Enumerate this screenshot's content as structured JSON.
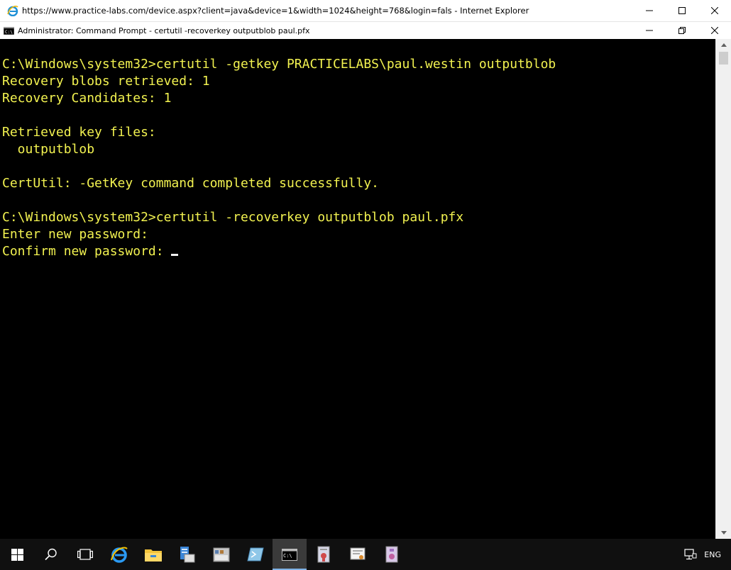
{
  "browser_window": {
    "title": "https://www.practice-labs.com/device.aspx?client=java&device=1&width=1024&height=768&login=fals - Internet Explorer",
    "icon": "ie-icon"
  },
  "cmd_window": {
    "title": "Administrator: Command Prompt - certutil  -recoverkey outputblob paul.pfx",
    "icon": "cmd-icon"
  },
  "console": {
    "text_color": "#f2f250",
    "background": "#000000",
    "lines": [
      "C:\\Windows\\system32>certutil -getkey PRACTICELABS\\paul.westin outputblob",
      "Recovery blobs retrieved: 1",
      "Recovery Candidates: 1",
      "",
      "Retrieved key files:",
      "  outputblob",
      "",
      "CertUtil: -GetKey command completed successfully.",
      "",
      "C:\\Windows\\system32>certutil -recoverkey outputblob paul.pfx",
      "Enter new password:",
      "Confirm new password: "
    ]
  },
  "taskbar": {
    "items": [
      "start-icon",
      "search-icon",
      "task-view-icon",
      "internet-explorer-icon",
      "file-explorer-icon",
      "server-manager-icon",
      "tools-icon",
      "powershell-icon",
      "command-prompt-icon",
      "certificate-authority-icon",
      "certificate-templates-icon",
      "archive-icon"
    ],
    "active_item": "command-prompt-icon",
    "tray": {
      "language": "ENG"
    }
  }
}
